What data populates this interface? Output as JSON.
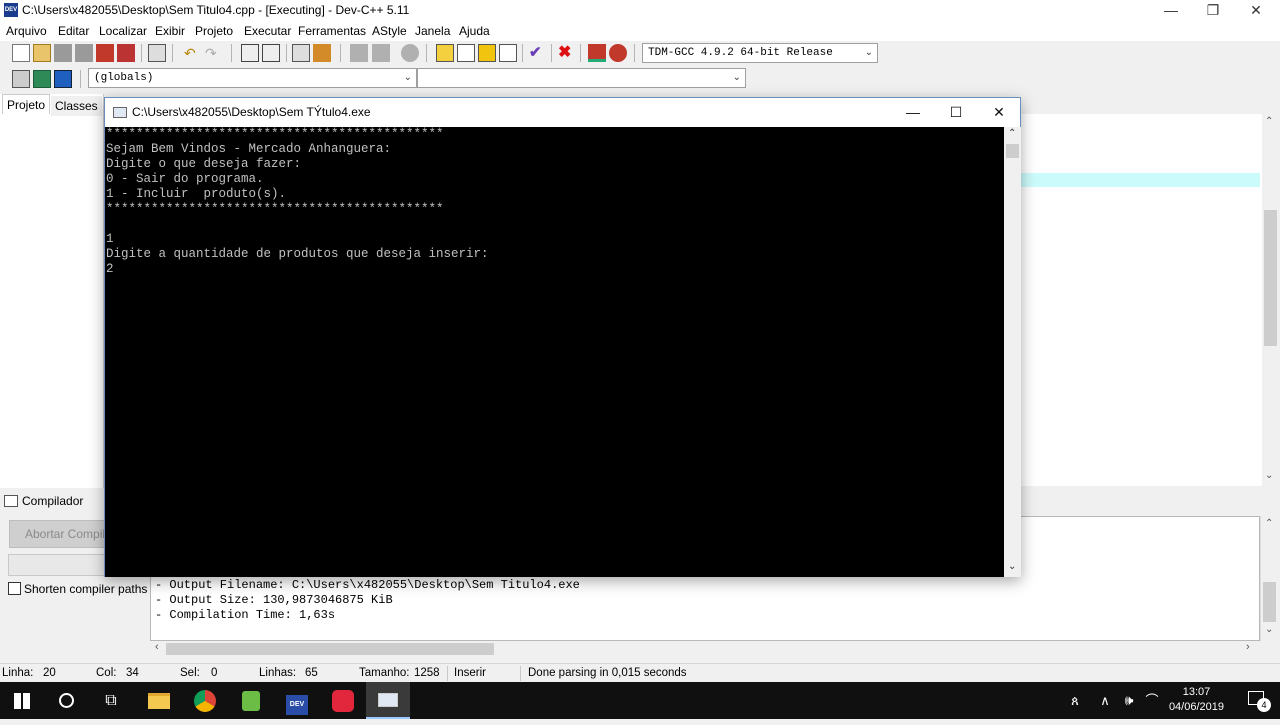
{
  "window": {
    "title": "C:\\Users\\x482055\\Desktop\\Sem Titulo4.cpp - [Executing] - Dev-C++ 5.11",
    "app_icon": "DEV",
    "minimize_icon": "—",
    "restore_icon": "❐",
    "close_icon": "✕"
  },
  "menu": [
    "Arquivo",
    "Editar",
    "Localizar",
    "Exibir",
    "Projeto",
    "Executar",
    "Ferramentas",
    "AStyle",
    "Janela",
    "Ajuda"
  ],
  "toolbar": {
    "compiler_select": "TDM-GCC 4.9.2 64-bit Release",
    "scope_select": "(globals)",
    "symbol_select": ""
  },
  "left_panel": {
    "tabs": [
      "Projeto",
      "Classes"
    ]
  },
  "bottom_panel": {
    "tab_label": "Compilador",
    "abort_button": "Abortar Compilação",
    "shorten_paths_label": "Shorten compiler paths",
    "log_lines": [
      "- Output Filename: C:\\Users\\x482055\\Desktop\\Sem Titulo4.exe",
      "- Output Size: 130,9873046875 KiB",
      "- Compilation Time: 1,63s"
    ]
  },
  "status_bar": {
    "linha_label": "Linha:",
    "linha_value": "20",
    "col_label": "Col:",
    "col_value": "34",
    "sel_label": "Sel:",
    "sel_value": "0",
    "linhas_label": "Linhas:",
    "linhas_value": "65",
    "tamanho_label": "Tamanho:",
    "tamanho_value": "1258",
    "mode": "Inserir",
    "message": "Done parsing in 0,015 seconds"
  },
  "console": {
    "title": "C:\\Users\\x482055\\Desktop\\Sem TÝtulo4.exe",
    "minimize_icon": "—",
    "maximize_icon": "☐",
    "close_icon": "✕",
    "lines": [
      "*********************************************",
      "Sejam Bem Vindos - Mercado Anhanguera:",
      "Digite o que deseja fazer:",
      "0 - Sair do programa.",
      "1 - Incluir  produto(s).",
      "*********************************************",
      "",
      "1",
      "Digite a quantidade de produtos que deseja inserir:",
      "2"
    ]
  },
  "taskbar": {
    "time": "13:07",
    "date": "04/06/2019",
    "notification_count": "4"
  }
}
